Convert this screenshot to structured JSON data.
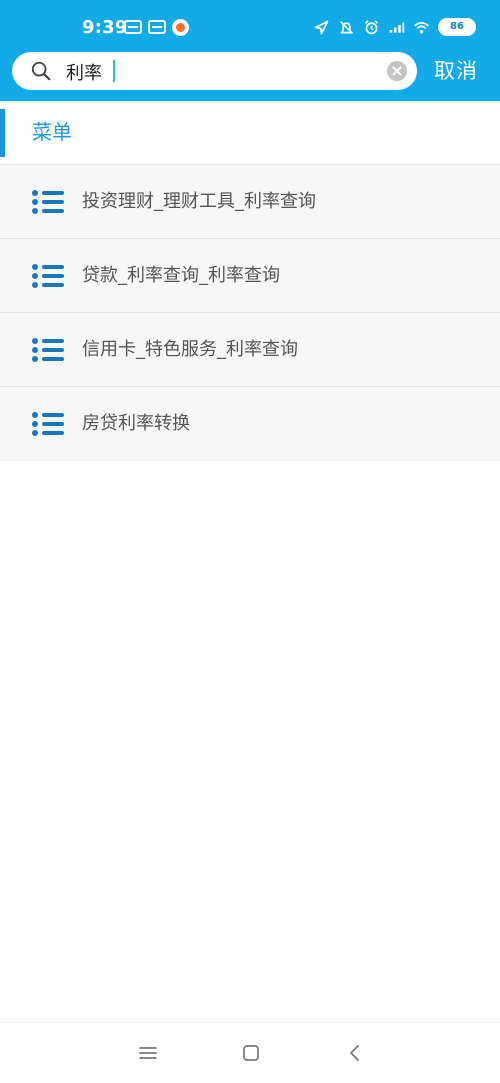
{
  "status_bar": {
    "time": "9:39",
    "battery": "86"
  },
  "search": {
    "value": "利率",
    "placeholder": "",
    "cancel_label": "取消"
  },
  "section": {
    "title": "菜单",
    "accent_color": "#1a97de"
  },
  "results": [
    {
      "label": "投资理财_理财工具_利率查询"
    },
    {
      "label": "贷款_利率查询_利率查询"
    },
    {
      "label": "信用卡_特色服务_利率查询"
    },
    {
      "label": "房贷利率转换"
    }
  ],
  "theme": {
    "header_bg": "#12abe8",
    "list_bg": "#f7f7f7",
    "icon_color": "#1b76bb"
  },
  "icons": {
    "search": "search-icon",
    "clear": "clear-icon",
    "list": "list-icon",
    "menu": "menu-icon",
    "home": "home-icon",
    "back": "back-icon"
  }
}
